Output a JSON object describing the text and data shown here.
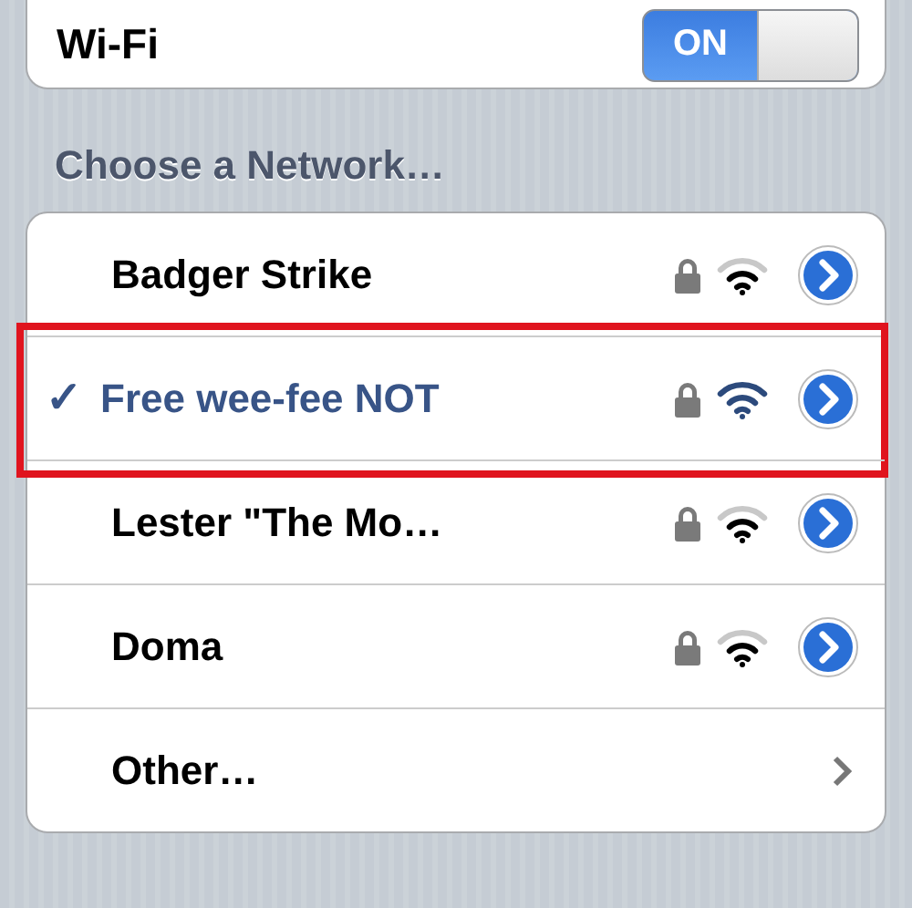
{
  "wifi": {
    "label": "Wi-Fi",
    "on": true,
    "toggle_text": "ON"
  },
  "section_title": "Choose a Network…",
  "networks": [
    {
      "kind": "network",
      "name": "Badger Strike",
      "selected": false,
      "locked": true,
      "highlighted": false
    },
    {
      "kind": "network",
      "name": "Free wee-fee NOT",
      "selected": true,
      "check": "✓",
      "locked": true,
      "highlighted": true
    },
    {
      "kind": "network",
      "name": "Lester \"The Mo…",
      "selected": false,
      "locked": true,
      "highlighted": false
    },
    {
      "kind": "network",
      "name": "Doma",
      "selected": false,
      "locked": true,
      "highlighted": false
    },
    {
      "kind": "other",
      "name": "Other…"
    }
  ]
}
